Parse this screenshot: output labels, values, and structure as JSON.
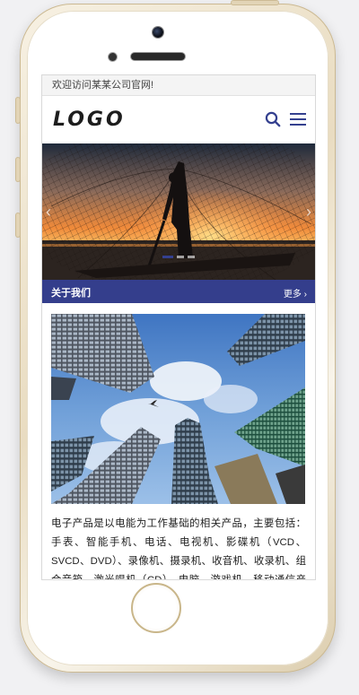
{
  "welcome": {
    "text": "欢迎访问某某公司官网!"
  },
  "header": {
    "logo": "LOGO",
    "search_icon": "search-icon",
    "menu_icon": "menu-icon"
  },
  "banner": {
    "slides": 3,
    "active_slide": 1,
    "prev_icon": "chevron-left-icon",
    "next_icon": "chevron-right-icon"
  },
  "about": {
    "title": "关于我们",
    "more": "更多 ›",
    "description": "电子产品是以电能为工作基础的相关产品，主要包括：手表、智能手机、电话、电视机、影碟机（VCD、SVCD、DVD）、录像机、摄录机、收音机、收录机、组合音箱、激光唱机（CD）、电脑、游戏机、移动通信产品等。因早期"
  },
  "colors": {
    "accent": "#343e8c",
    "icon": "#34408f"
  }
}
